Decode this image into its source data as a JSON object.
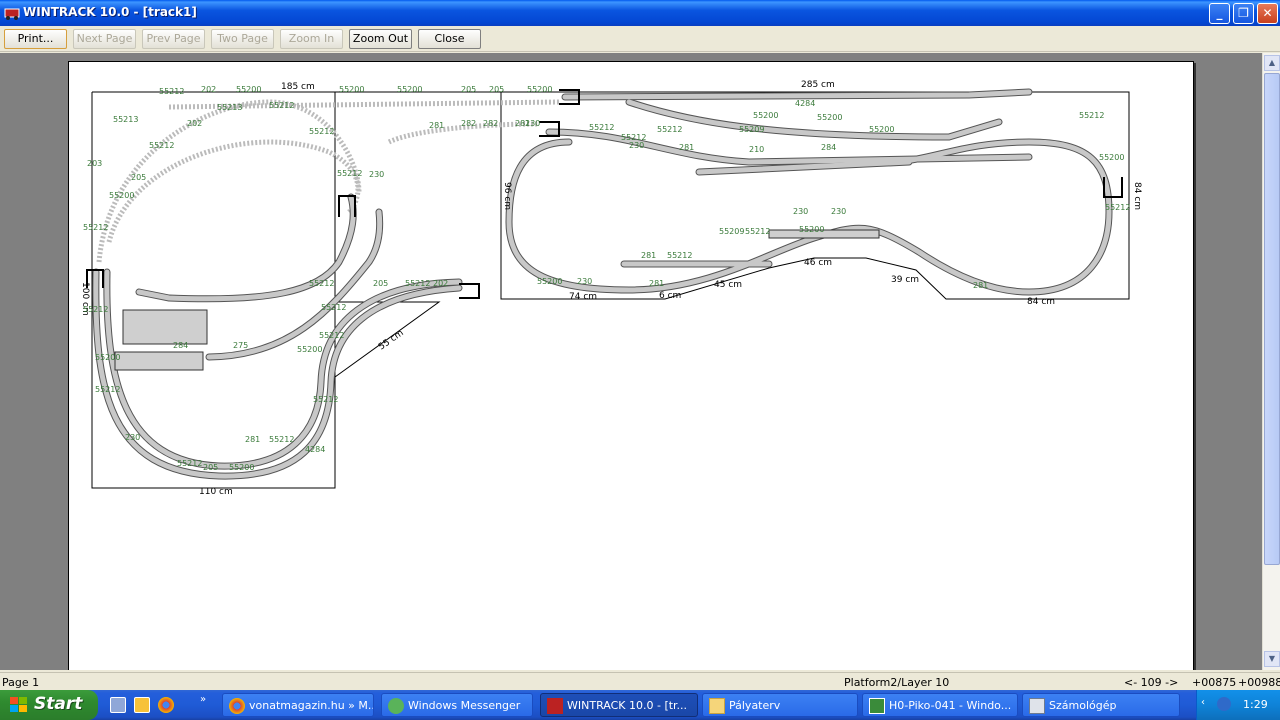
{
  "window": {
    "title": "WINTRACK 10.0 - [track1]"
  },
  "toolbar": {
    "print": "Print...",
    "next_page": "Next Page",
    "prev_page": "Prev Page",
    "two_page": "Two Page",
    "zoom_in": "Zoom In",
    "zoom_out": "Zoom Out",
    "close": "Close"
  },
  "layout": {
    "dim_top_left": "185 cm",
    "dim_top_right": "285 cm",
    "dim_right": "84 cm",
    "dim_left": "100 cm",
    "dim_middle": "96 cm",
    "dim_bottom_left": "110 cm",
    "dim_diag_55": "55 cm",
    "dim_74": "74 cm",
    "dim_6": "6 cm",
    "dim_45": "45 cm",
    "dim_46": "46 cm",
    "dim_39": "39 cm",
    "dim_84b": "84 cm",
    "labels": [
      "55212",
      "202",
      "55200",
      "55200",
      "55200",
      "205",
      "205",
      "55200",
      "55213",
      "55212",
      "55213",
      "202",
      "55212",
      "55212",
      "203",
      "205",
      "55200",
      "55212",
      "55212",
      "230",
      "281",
      "282",
      "282",
      "281",
      "230",
      "55212",
      "55212",
      "4284",
      "55200",
      "55200",
      "55200",
      "55212",
      "55209",
      "55212",
      "55200",
      "281",
      "210",
      "284",
      "230",
      "55212",
      "55200",
      "230",
      "230",
      "281",
      "55212",
      "55209",
      "55212",
      "284",
      "275",
      "55212",
      "205",
      "55212",
      "202",
      "55212",
      "55200",
      "55212",
      "230",
      "55212",
      "55200",
      "205",
      "55212",
      "281",
      "55200",
      "55212",
      "55212",
      "4284",
      "55212",
      "55200",
      "230",
      "281",
      "281"
    ]
  },
  "statusbar": {
    "page": "Page 1",
    "layer": "Platform2/Layer 10",
    "nav": "<- 109 ->",
    "coord_x": "+00875",
    "coord_y": "+00988"
  },
  "taskbar": {
    "start": "Start",
    "tasks": [
      {
        "label": "vonatmagazin.hu » M..."
      },
      {
        "label": "Windows Messenger"
      },
      {
        "label": "WINTRACK 10.0 - [tr..."
      },
      {
        "label": "Pályaterv"
      },
      {
        "label": "H0-Piko-041 - Windo..."
      },
      {
        "label": "Számológép"
      }
    ],
    "clock": "1:29"
  },
  "colors": {
    "title_bar": "#0a55e0",
    "track_fill": "#c8c8c8",
    "track_border": "#333333",
    "label_green": "#3a7a3a"
  }
}
